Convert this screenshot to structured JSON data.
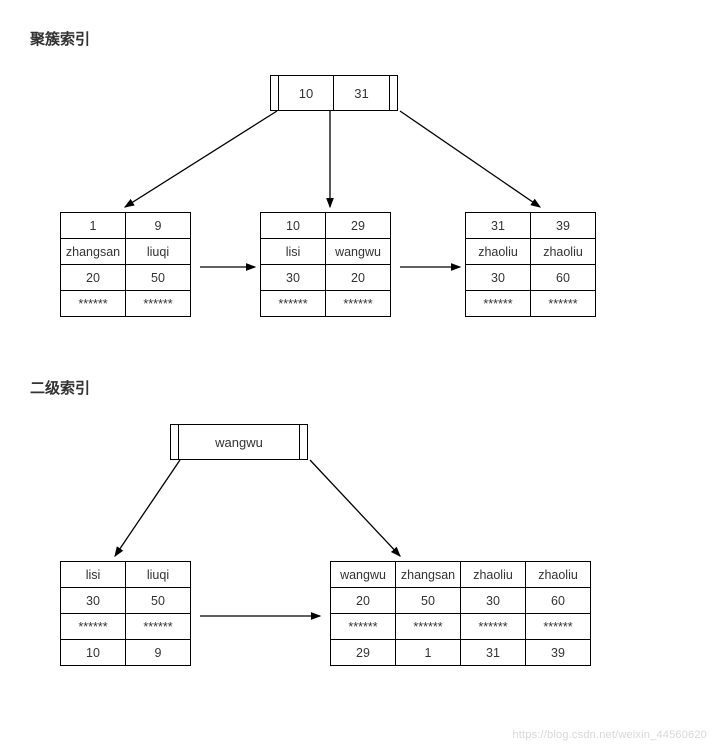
{
  "section1": {
    "title": "聚簇索引",
    "root": {
      "cells": [
        "10",
        "31"
      ]
    },
    "leaves": [
      {
        "cols": 2,
        "rows": [
          [
            "1",
            "9"
          ],
          [
            "zhangsan",
            "liuqi"
          ],
          [
            "20",
            "50"
          ],
          [
            "******",
            "******"
          ]
        ]
      },
      {
        "cols": 2,
        "rows": [
          [
            "10",
            "29"
          ],
          [
            "lisi",
            "wangwu"
          ],
          [
            "30",
            "20"
          ],
          [
            "******",
            "******"
          ]
        ]
      },
      {
        "cols": 2,
        "rows": [
          [
            "31",
            "39"
          ],
          [
            "zhaoliu",
            "zhaoliu"
          ],
          [
            "30",
            "60"
          ],
          [
            "******",
            "******"
          ]
        ]
      }
    ]
  },
  "section2": {
    "title": "二级索引",
    "root": {
      "label": "wangwu"
    },
    "leaves": [
      {
        "cols": 2,
        "rows": [
          [
            "lisi",
            "liuqi"
          ],
          [
            "30",
            "50"
          ],
          [
            "******",
            "******"
          ],
          [
            "10",
            "9"
          ]
        ]
      },
      {
        "cols": 4,
        "rows": [
          [
            "wangwu",
            "zhangsan",
            "zhaoliu",
            "zhaoliu"
          ],
          [
            "20",
            "50",
            "30",
            "60"
          ],
          [
            "******",
            "******",
            "******",
            "******"
          ],
          [
            "29",
            "1",
            "31",
            "39"
          ]
        ]
      }
    ]
  },
  "watermark": "https://blog.csdn.net/weixin_44560620"
}
